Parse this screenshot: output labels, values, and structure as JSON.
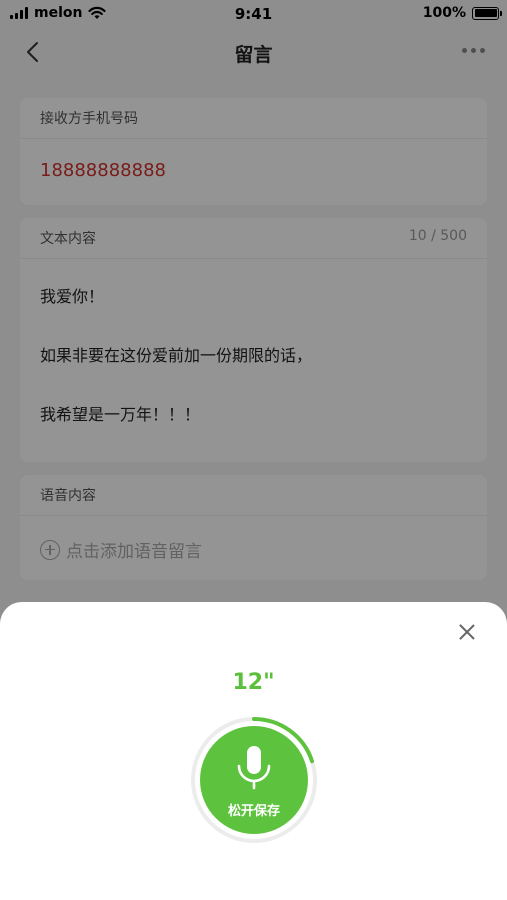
{
  "status_bar": {
    "carrier": "melon",
    "time": "9:41",
    "battery": "100%"
  },
  "nav": {
    "title": "留言",
    "back_icon": "chevron-left-icon",
    "more_icon": "more-dots-icon"
  },
  "recipient": {
    "label": "接收方手机号码",
    "phone": "18888888888"
  },
  "text_content": {
    "label": "文本内容",
    "counter": "10 / 500",
    "lines": [
      "我爱你！",
      "如果非要在这份爱前加一份期限的话，",
      "我希望是一万年！！！"
    ]
  },
  "voice_content": {
    "label": "语音内容",
    "add_label": "点击添加语音留言"
  },
  "recorder": {
    "timer": "12\"",
    "button_label": "松开保存",
    "progress": 0.2,
    "accent_color": "#5dc33e"
  }
}
